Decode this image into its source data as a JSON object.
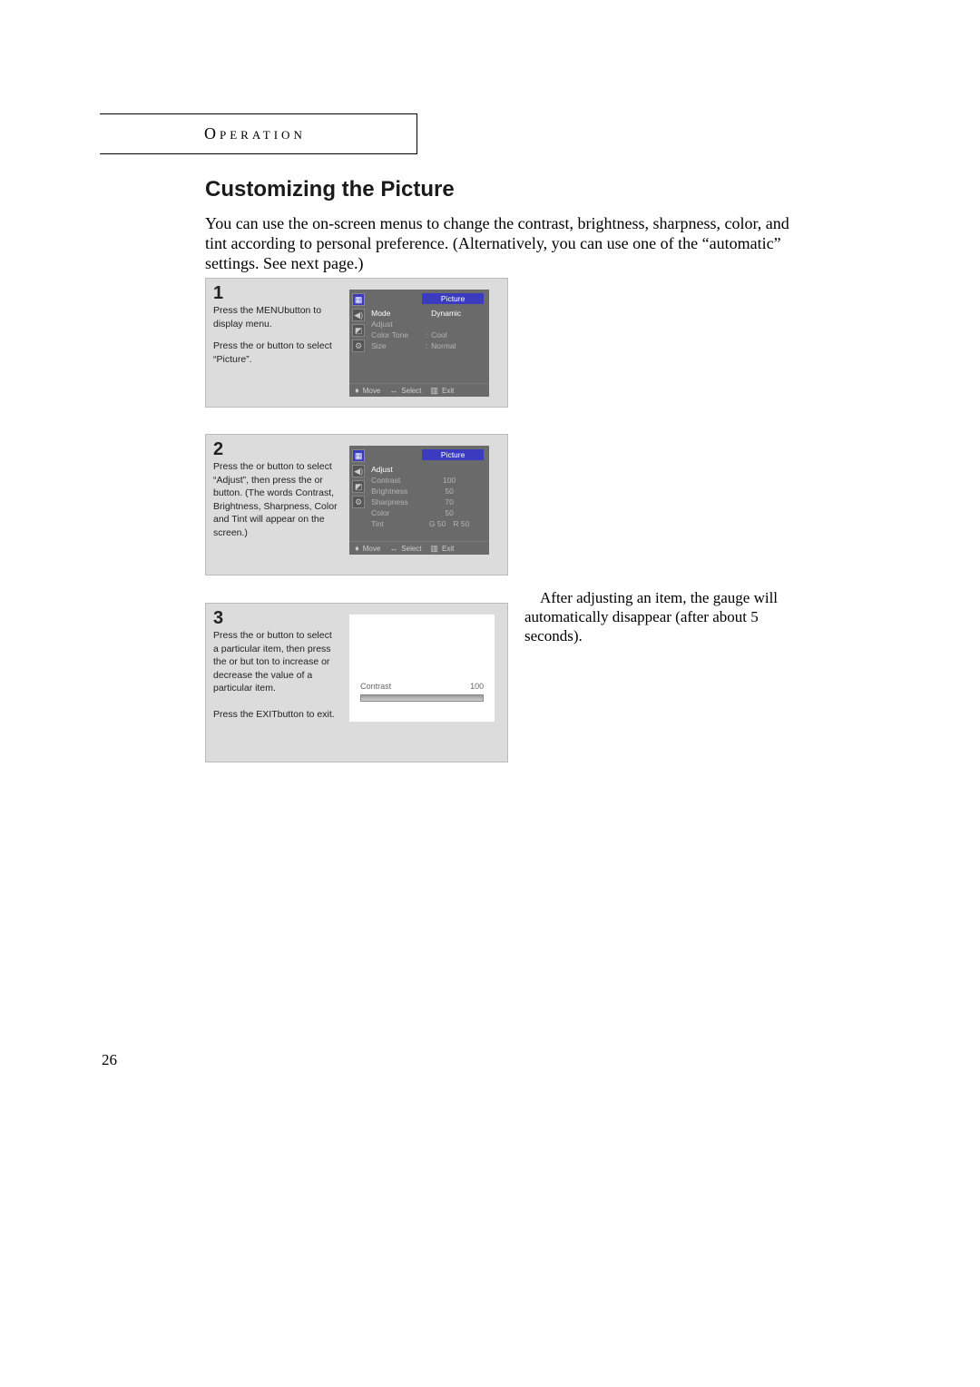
{
  "header_label": "Operation",
  "title": "Customizing the Picture",
  "intro": "You can use the on-screen menus to change the contrast, brightness, sharpness, color, and tint according to personal preference. (Alternatively, you can use one of the “automatic” settings. See next page.)",
  "steps": {
    "s1": {
      "num": "1",
      "line1a": "Press the MENU",
      "line1b": "button to display menu.",
      "line2a": "Press the ",
      "line2b": " or ",
      "line2c": " button to select “Picture”."
    },
    "s2": {
      "num": "2",
      "line1a": "Press the ",
      "line1b": " or ",
      "line1c": " button to select “Adjust”, then press the ",
      "line1d": " or ",
      "line1e": " button. (The words Contrast, Brightness, Sharpness, Color and Tint will appear on the screen.)"
    },
    "s3": {
      "num": "3",
      "line1a": "Press the ",
      "line1b": " or ",
      "line1c": " button to select a particular item, then press the ",
      "line1d": " or ",
      "line1e": " but­ ton to increase or decrease the value of a particular item.",
      "below_a": "Press the EXIT",
      "below_b": "button to exit."
    }
  },
  "osd": {
    "title": "Picture",
    "footer": {
      "move": "Move",
      "select": "Select",
      "exit": "Exit"
    },
    "menu1": {
      "rows": [
        {
          "label": "Mode",
          "value": "Dynamic",
          "hi": true,
          "colon": ""
        },
        {
          "label": "Adjust",
          "value": "",
          "hi": false,
          "colon": ""
        },
        {
          "label": "Color Tone",
          "value": "Cool",
          "hi": false,
          "colon": ":"
        },
        {
          "label": "Size",
          "value": "Normal",
          "hi": false,
          "colon": ":"
        }
      ]
    },
    "menu2": {
      "rows": [
        {
          "label": "Adjust",
          "value": "",
          "hi": true
        },
        {
          "label": "Contrast",
          "value": "100",
          "hi": false
        },
        {
          "label": "Brightness",
          "value": "50",
          "hi": false
        },
        {
          "label": "Sharpness",
          "value": "70",
          "hi": false
        },
        {
          "label": "Color",
          "value": "50",
          "hi": false
        },
        {
          "label": "Tint",
          "g": "G  50",
          "r": "R  50",
          "hi": false
        }
      ]
    }
  },
  "gauge": {
    "label": "Contrast",
    "value": "100",
    "pct": 100
  },
  "sidenote": "    After adjusting an item, the gauge will automatically disappear (after about 5 seconds).",
  "page_number": "26"
}
